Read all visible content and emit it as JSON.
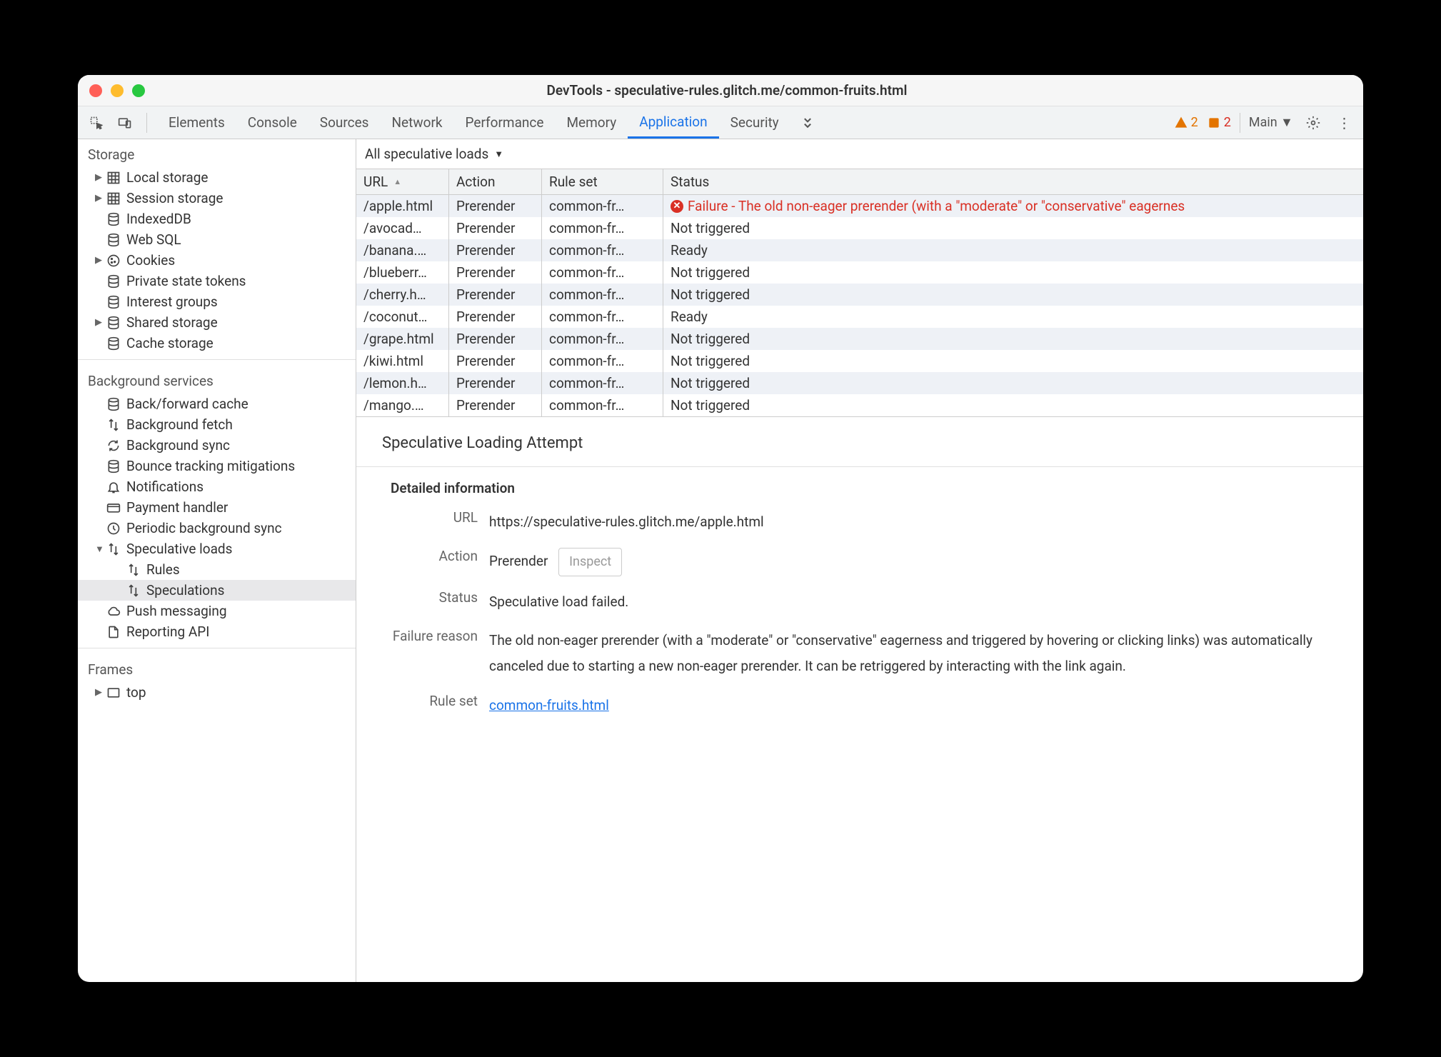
{
  "title": "DevTools - speculative-rules.glitch.me/common-fruits.html",
  "tabs": [
    "Elements",
    "Console",
    "Sources",
    "Network",
    "Performance",
    "Memory",
    "Application",
    "Security"
  ],
  "active_tab": "Application",
  "badges": {
    "warn": "2",
    "err": "2"
  },
  "main_label": "Main",
  "sidebar": {
    "storage_title": "Storage",
    "storage_items": [
      {
        "label": "Local storage",
        "icon": "grid",
        "arrow": true
      },
      {
        "label": "Session storage",
        "icon": "grid",
        "arrow": true
      },
      {
        "label": "IndexedDB",
        "icon": "db",
        "arrow": false
      },
      {
        "label": "Web SQL",
        "icon": "db",
        "arrow": false
      },
      {
        "label": "Cookies",
        "icon": "cookie",
        "arrow": true
      },
      {
        "label": "Private state tokens",
        "icon": "db",
        "arrow": false
      },
      {
        "label": "Interest groups",
        "icon": "db",
        "arrow": false
      },
      {
        "label": "Shared storage",
        "icon": "db",
        "arrow": true
      },
      {
        "label": "Cache storage",
        "icon": "db",
        "arrow": false
      }
    ],
    "bg_title": "Background services",
    "bg_items": [
      {
        "label": "Back/forward cache",
        "icon": "db"
      },
      {
        "label": "Background fetch",
        "icon": "updown"
      },
      {
        "label": "Background sync",
        "icon": "sync"
      },
      {
        "label": "Bounce tracking mitigations",
        "icon": "db"
      },
      {
        "label": "Notifications",
        "icon": "bell"
      },
      {
        "label": "Payment handler",
        "icon": "card"
      },
      {
        "label": "Periodic background sync",
        "icon": "clock"
      },
      {
        "label": "Speculative loads",
        "icon": "updown",
        "expanded": true
      },
      {
        "label": "Rules",
        "icon": "updown",
        "child": true
      },
      {
        "label": "Speculations",
        "icon": "updown",
        "child": true,
        "selected": true
      },
      {
        "label": "Push messaging",
        "icon": "cloud"
      },
      {
        "label": "Reporting API",
        "icon": "doc"
      }
    ],
    "frames_title": "Frames",
    "frames_items": [
      {
        "label": "top",
        "icon": "frame",
        "arrow": true
      }
    ]
  },
  "filter": "All speculative loads",
  "columns": [
    "URL",
    "Action",
    "Rule set",
    "Status"
  ],
  "rows": [
    {
      "url": "/apple.html",
      "action": "Prerender",
      "rule": "common-fr…",
      "status": "Failure - The old non-eager prerender (with a \"moderate\" or \"conservative\" eagernes",
      "error": true
    },
    {
      "url": "/avocad…",
      "action": "Prerender",
      "rule": "common-fr…",
      "status": "Not triggered"
    },
    {
      "url": "/banana.…",
      "action": "Prerender",
      "rule": "common-fr…",
      "status": "Ready"
    },
    {
      "url": "/blueberr…",
      "action": "Prerender",
      "rule": "common-fr…",
      "status": "Not triggered"
    },
    {
      "url": "/cherry.h…",
      "action": "Prerender",
      "rule": "common-fr…",
      "status": "Not triggered"
    },
    {
      "url": "/coconut…",
      "action": "Prerender",
      "rule": "common-fr…",
      "status": "Ready"
    },
    {
      "url": "/grape.html",
      "action": "Prerender",
      "rule": "common-fr…",
      "status": "Not triggered"
    },
    {
      "url": "/kiwi.html",
      "action": "Prerender",
      "rule": "common-fr…",
      "status": "Not triggered"
    },
    {
      "url": "/lemon.h…",
      "action": "Prerender",
      "rule": "common-fr…",
      "status": "Not triggered"
    },
    {
      "url": "/mango.…",
      "action": "Prerender",
      "rule": "common-fr…",
      "status": "Not triggered"
    }
  ],
  "detail": {
    "title": "Speculative Loading Attempt",
    "subtitle": "Detailed information",
    "labels": {
      "url": "URL",
      "action": "Action",
      "status": "Status",
      "reason": "Failure reason",
      "ruleset": "Rule set"
    },
    "url": "https://speculative-rules.glitch.me/apple.html",
    "action": "Prerender",
    "inspect": "Inspect",
    "status": "Speculative load failed.",
    "failure_reason": "The old non-eager prerender (with a \"moderate\" or \"conservative\" eagerness and triggered by hovering or clicking links) was automatically canceled due to starting a new non-eager prerender. It can be retriggered by interacting with the link again.",
    "rule_set": "common-fruits.html"
  }
}
